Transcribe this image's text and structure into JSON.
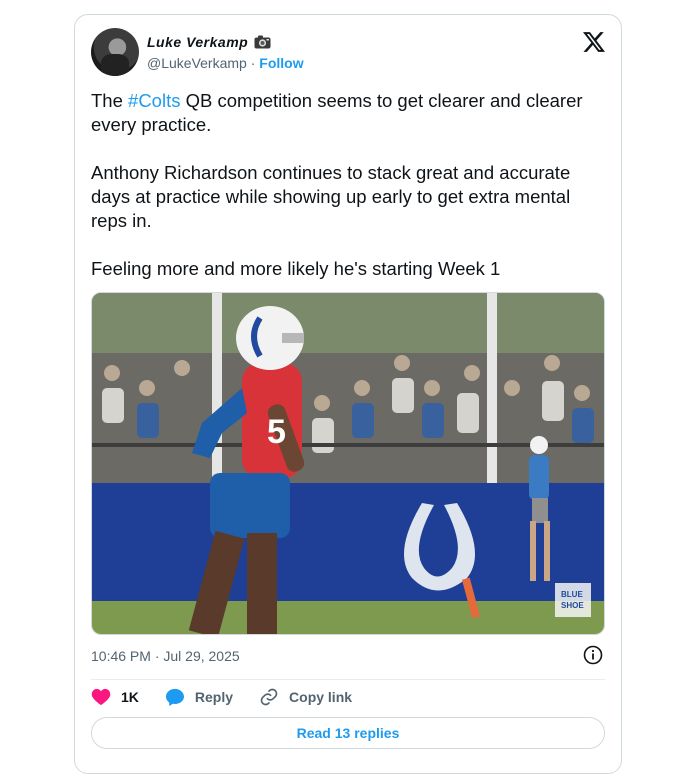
{
  "author": {
    "display_name": "Luke Verkamp",
    "name_badge_icon": "camera-icon",
    "handle": "@LukeVerkamp",
    "separator": " · ",
    "follow_label": "Follow"
  },
  "platform_icon": "x-logo-icon",
  "tweet": {
    "line1_pre": "The ",
    "hashtag": "#Colts",
    "line1_post": " QB competition seems to get clearer and clearer every practice.",
    "paragraph2": "Anthony Richardson continues to stack great and accurate days at practice while showing up early to get extra mental reps in.",
    "paragraph3": "Feeling more and more likely he's starting Week 1"
  },
  "media": {
    "jersey_number": "5",
    "watermark_line1": "BLUE",
    "watermark_line2": "SHOE"
  },
  "timestamp": "10:46 PM · Jul 29, 2025",
  "actions": {
    "likes": "1K",
    "reply_label": "Reply",
    "copy_link_label": "Copy link"
  },
  "read_replies_label": "Read 13 replies",
  "colors": {
    "accent": "#1d9bf0",
    "like": "#f91880",
    "muted": "#536471"
  }
}
